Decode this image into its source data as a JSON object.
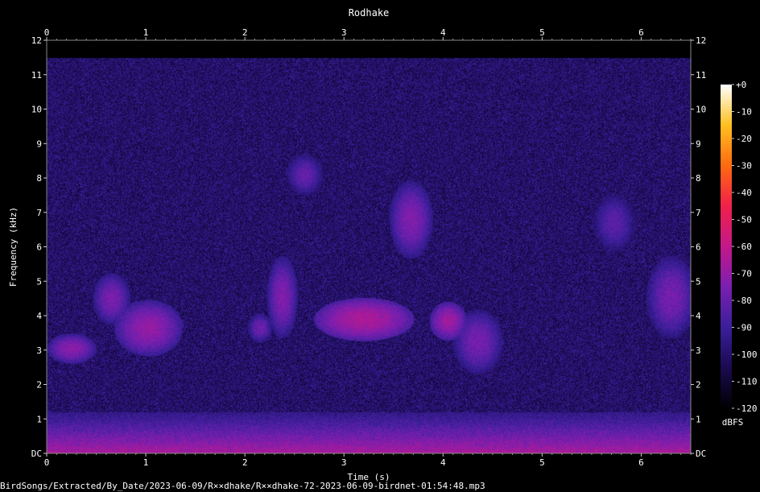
{
  "chart_data": {
    "type": "heatmap",
    "title": "Rodhake",
    "xlabel": "Time (s)",
    "ylabel": "Frequency (kHz)",
    "xlim": [
      0,
      6.5
    ],
    "ylim": [
      0,
      12
    ],
    "x_ticks": [
      "0",
      "1",
      "2",
      "3",
      "4",
      "5",
      "6"
    ],
    "y_ticks": [
      "DC",
      "1",
      "2",
      "3",
      "4",
      "5",
      "6",
      "7",
      "8",
      "9",
      "10",
      "11",
      "12"
    ],
    "colorbar": {
      "label": "dBFS",
      "range": [
        -120,
        0
      ],
      "ticks": [
        "+0",
        "-10",
        "-20",
        "-30",
        "-40",
        "-50",
        "-60",
        "-70",
        "-80",
        "-90",
        "-100",
        "-110",
        "-120"
      ],
      "colors": [
        "#000000",
        "#1a0a50",
        "#3a1f9a",
        "#7a1fb0",
        "#c4188a",
        "#f0204a",
        "#ff6a10",
        "#ffc020",
        "#ffffff"
      ]
    },
    "noise_ceiling_khz": 11.5,
    "background_level_dbfs": -100,
    "low_band": {
      "from_khz": 0,
      "to_khz": 1.2,
      "peak_dbfs": -65
    },
    "energy_regions": [
      {
        "t0": 0.05,
        "t1": 0.45,
        "f0": 2.7,
        "f1": 3.4,
        "level_dbfs": -72
      },
      {
        "t0": 0.5,
        "t1": 0.8,
        "f0": 3.9,
        "f1": 5.1,
        "level_dbfs": -75
      },
      {
        "t0": 0.75,
        "t1": 1.3,
        "f0": 3.0,
        "f1": 4.3,
        "level_dbfs": -70
      },
      {
        "t0": 2.05,
        "t1": 2.25,
        "f0": 3.3,
        "f1": 4.0,
        "level_dbfs": -78
      },
      {
        "t0": 2.25,
        "t1": 2.5,
        "f0": 3.6,
        "f1": 5.5,
        "level_dbfs": -74
      },
      {
        "t0": 2.45,
        "t1": 2.75,
        "f0": 7.6,
        "f1": 8.6,
        "level_dbfs": -80
      },
      {
        "t0": 2.8,
        "t1": 3.6,
        "f0": 3.4,
        "f1": 4.4,
        "level_dbfs": -65
      },
      {
        "t0": 3.5,
        "t1": 3.85,
        "f0": 5.9,
        "f1": 7.7,
        "level_dbfs": -74
      },
      {
        "t0": 3.9,
        "t1": 4.2,
        "f0": 3.4,
        "f1": 4.3,
        "level_dbfs": -68
      },
      {
        "t0": 4.15,
        "t1": 4.55,
        "f0": 2.5,
        "f1": 4.0,
        "level_dbfs": -76
      },
      {
        "t0": 5.55,
        "t1": 5.9,
        "f0": 6.0,
        "f1": 7.4,
        "level_dbfs": -82
      },
      {
        "t0": 6.1,
        "t1": 6.5,
        "f0": 3.6,
        "f1": 5.5,
        "level_dbfs": -76
      }
    ]
  },
  "file_path": "BirdSongs/Extracted/By_Date/2023-06-09/R××dhake/R××dhake-72-2023-06-09-birdnet-01:54:48.mp3"
}
